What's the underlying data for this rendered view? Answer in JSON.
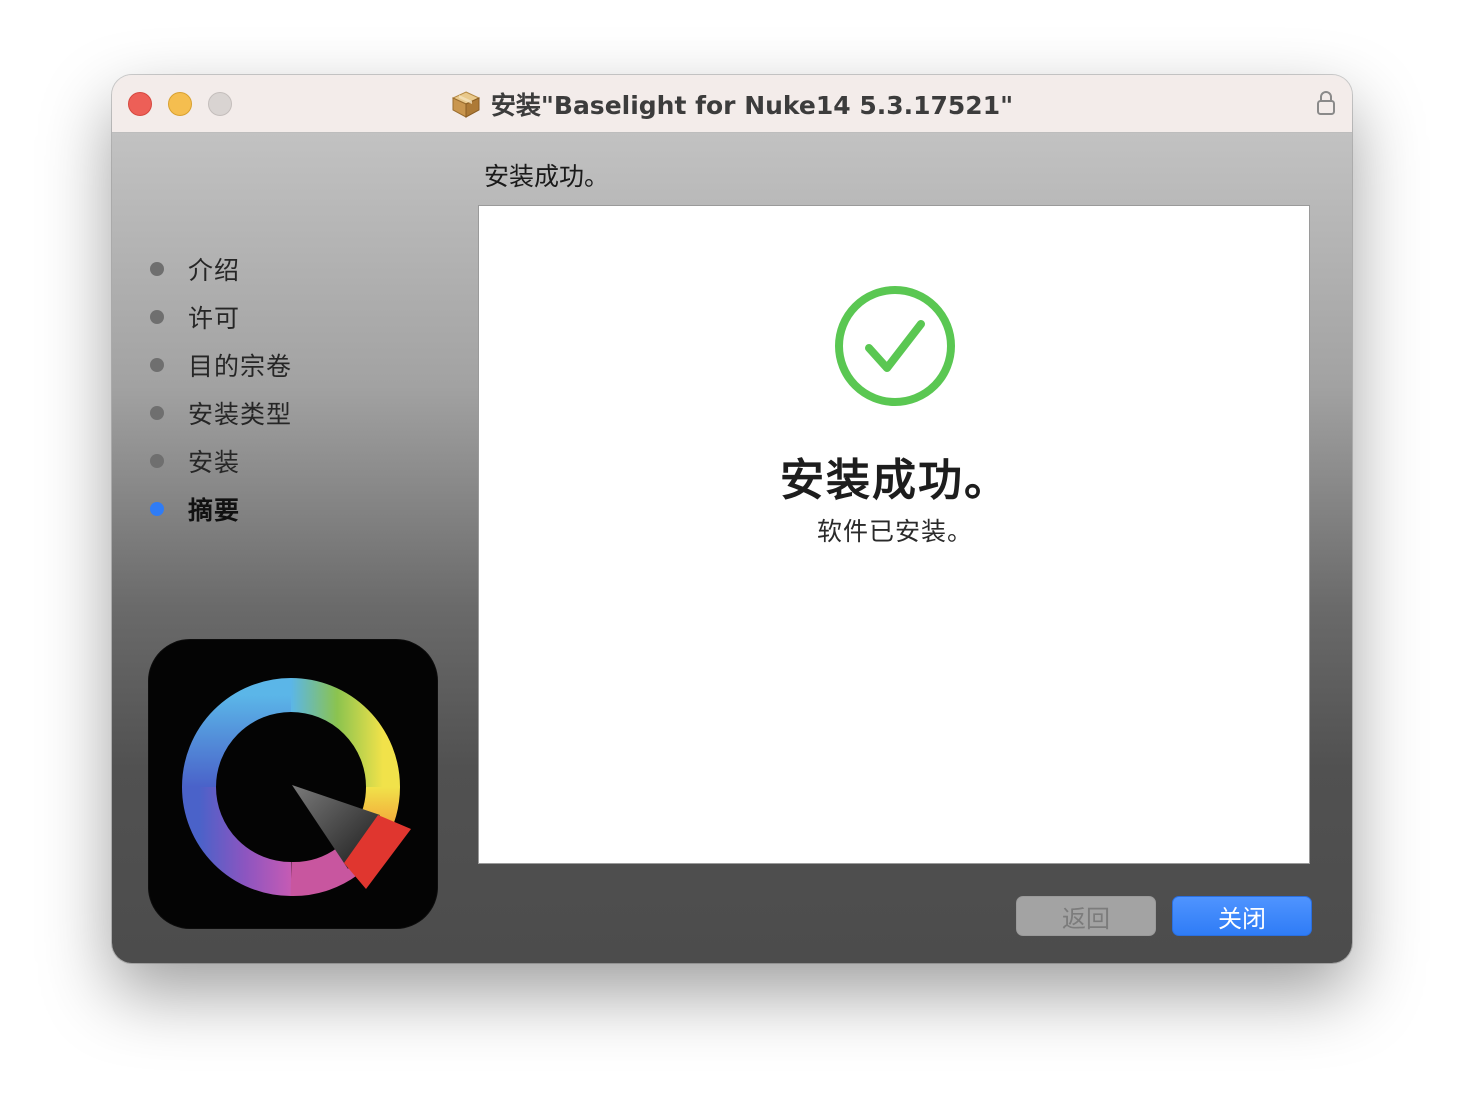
{
  "window": {
    "title": "安装\"Baselight for Nuke14 5.3.17521\"",
    "title_icon": "package-icon",
    "lock_icon": "lock-icon"
  },
  "header": {
    "status": "安装成功。"
  },
  "sidebar": {
    "steps": [
      {
        "label": "介绍",
        "active": false
      },
      {
        "label": "许可",
        "active": false
      },
      {
        "label": "目的宗卷",
        "active": false
      },
      {
        "label": "安装类型",
        "active": false
      },
      {
        "label": "安装",
        "active": false
      },
      {
        "label": "摘要",
        "active": true
      }
    ],
    "app_icon": "baselight-logo-icon"
  },
  "main": {
    "icon": "success-checkmark-icon",
    "title": "安装成功。",
    "subtitle": "软件已安装。"
  },
  "buttons": {
    "back_label": "返回",
    "back_enabled": false,
    "close_label": "关闭"
  },
  "colors": {
    "accent": "#2f7cf6",
    "success": "#5ac752",
    "close_dot": "#ed5f57",
    "minimize_dot": "#f5be4f"
  }
}
